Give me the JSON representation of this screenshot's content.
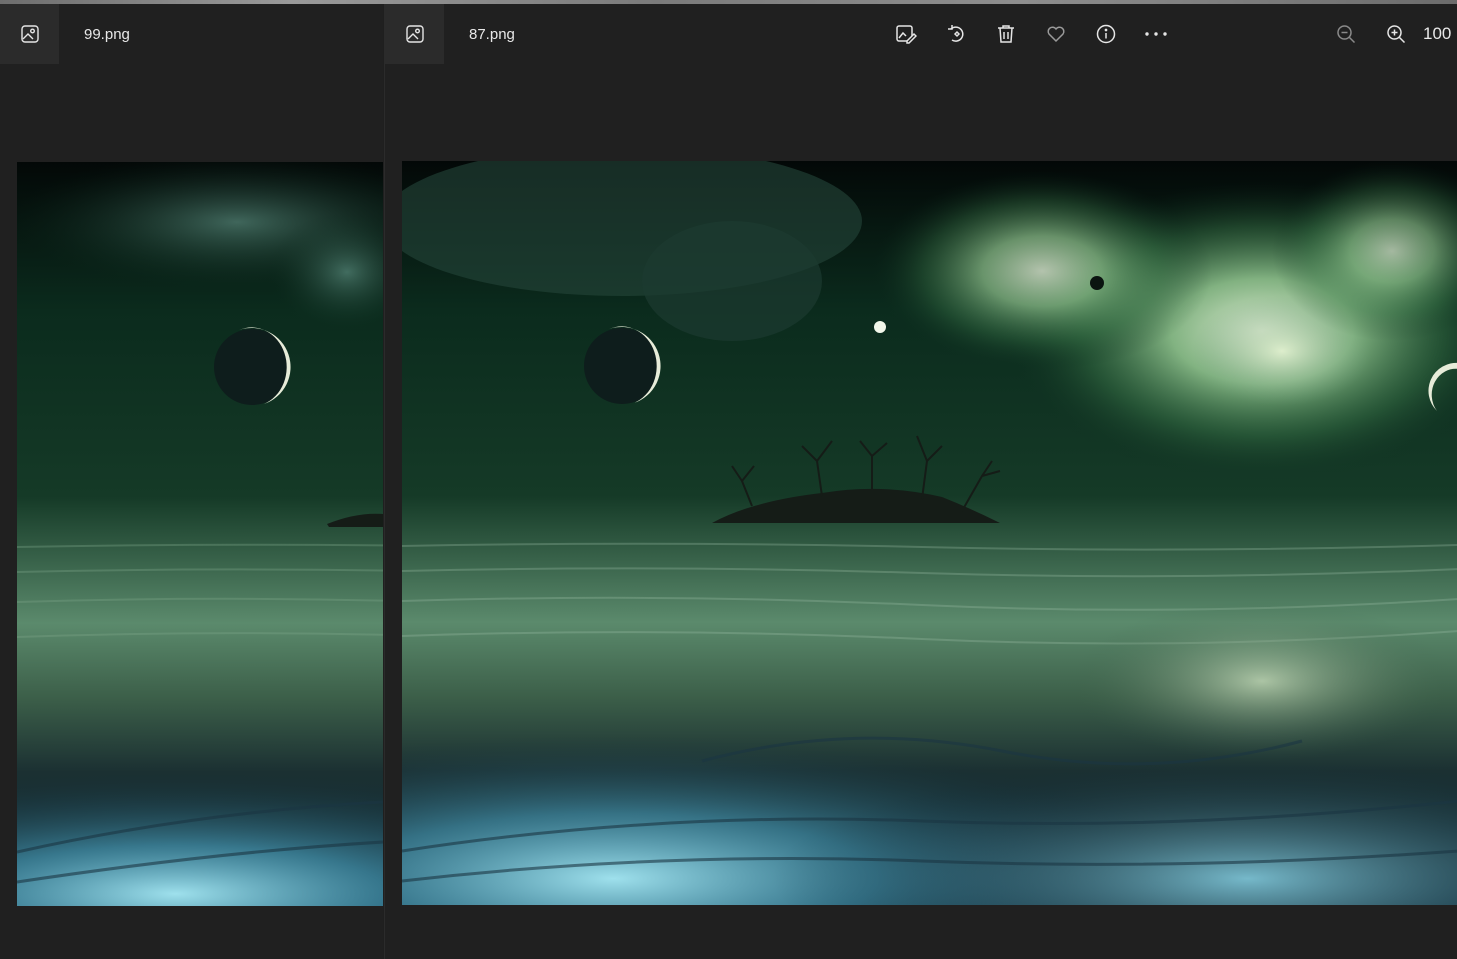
{
  "left_window": {
    "app_icon": "photo-icon",
    "file_name": "99.png"
  },
  "right_window": {
    "app_icon": "photo-icon",
    "file_name": "87.png",
    "toolbar": {
      "buttons": [
        {
          "icon": "edit-image-icon"
        },
        {
          "icon": "rotate-icon"
        },
        {
          "icon": "delete-icon"
        },
        {
          "icon": "favorite-heart-icon"
        },
        {
          "icon": "info-icon"
        },
        {
          "icon": "more-options-icon"
        }
      ],
      "zoom_out_icon": "zoom-out-icon",
      "zoom_in_icon": "zoom-in-icon",
      "zoom_level": "100"
    }
  },
  "colors": {
    "window_bg": "#202020",
    "titlebar_icon_bg": "#2b2b2b",
    "text": "#e8e8e8",
    "sky_dark": "#06140e",
    "nebula_green": "#9fd49a",
    "water_green": "#3f6b52",
    "glow_blue": "#7fd3ea"
  }
}
